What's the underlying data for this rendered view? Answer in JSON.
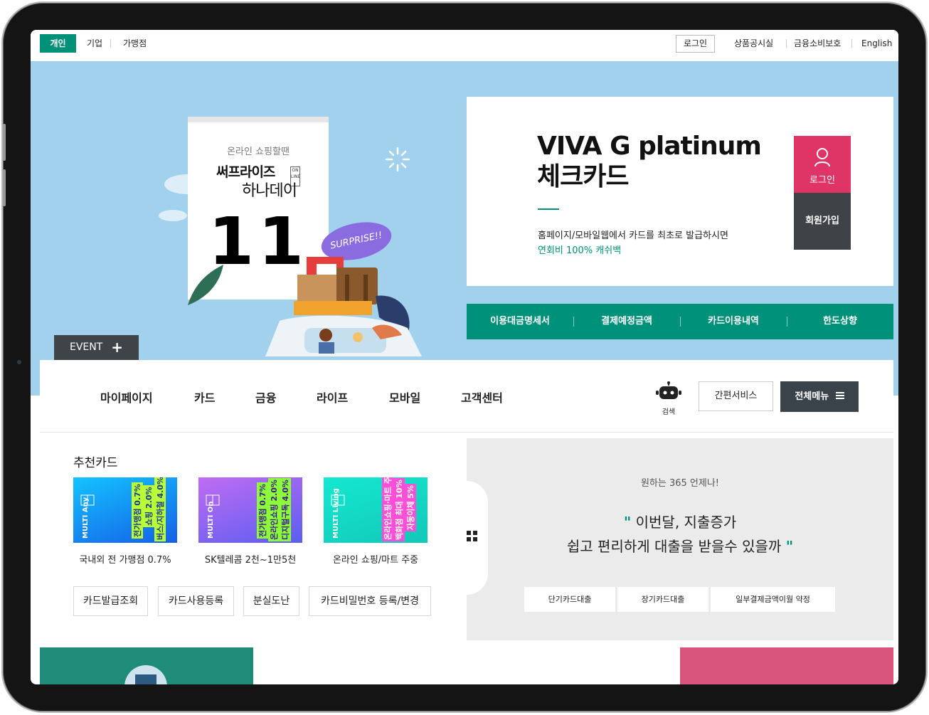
{
  "util_bar": {
    "tabs": [
      "개인",
      "기업",
      "가맹점"
    ],
    "login": "로그인",
    "links": [
      "상품공시실",
      "금융소비보호",
      "English"
    ]
  },
  "hero": {
    "calendar": {
      "subtitle": "온라인 쇼핑할땐",
      "brand": "써프라이즈",
      "online_badge": "ON LINE",
      "hanaday": "하나데이",
      "day": "11"
    },
    "speech_bubble": "SURPRISE!!",
    "event_label": "EVENT",
    "event_plus": "+"
  },
  "promo": {
    "title_line1": "VIVA G platinum",
    "title_line2": "체크카드",
    "desc": "홈페이지/모바일웹에서 카드를 최초로 발급하시면",
    "highlight": "연회비 100% 캐쉬백",
    "login": "로그인",
    "join": "회원가입"
  },
  "quick_links": [
    "이용대금명세서",
    "결제예정금액",
    "카드이용내역",
    "한도상향"
  ],
  "nav": {
    "items": [
      "마이페이지",
      "카드",
      "금융",
      "라이프",
      "모바일",
      "고객센터"
    ],
    "search_caption": "검색",
    "easy_service": "간편서비스",
    "all_menu": "전체메뉴"
  },
  "recommended": {
    "title": "추천카드",
    "cards": [
      {
        "caption": "국내외 전 가맹점 0.7%",
        "name": "MULTI Any",
        "perks": [
          "전가맹점 0.7%",
          "쇼핑 2.0%",
          "버스/지하철 4.0%"
        ]
      },
      {
        "caption": "SK텔레콤 2천~1만5천",
        "name": "MULTI On",
        "perks": [
          "전가맹점 0.7%",
          "온라인쇼핑 2.0%",
          "디지털구독 4.0%"
        ]
      },
      {
        "caption": "온라인 쇼핑/마트 주중",
        "name": "MULTI Living",
        "perks": [
          "온라인쇼핑·마트 주중",
          "백화점 최대 10%",
          "자동이체 5%"
        ]
      }
    ],
    "buttons": [
      "카드발급조회",
      "카드사용등록",
      "분실도난",
      "카드비밀번호 등록/변경"
    ]
  },
  "loan": {
    "subtitle": "원하는 365 언제나!",
    "open_quote": "\"",
    "line1": "이번달, 지출증가",
    "line2": "쉽고 편리하게 대출을 받을수 있을까",
    "close_quote": "\"",
    "buttons": [
      "단기카드대출",
      "장기카드대출",
      "일부결제금액이월 약정"
    ]
  },
  "colors": {
    "brand_green": "#009178",
    "hero_sky": "#a1d1ed",
    "login_pink": "#de3566",
    "dark_gray": "#3f4348",
    "band_teal": "#1f8c7a",
    "band_pink": "#d9557d"
  }
}
